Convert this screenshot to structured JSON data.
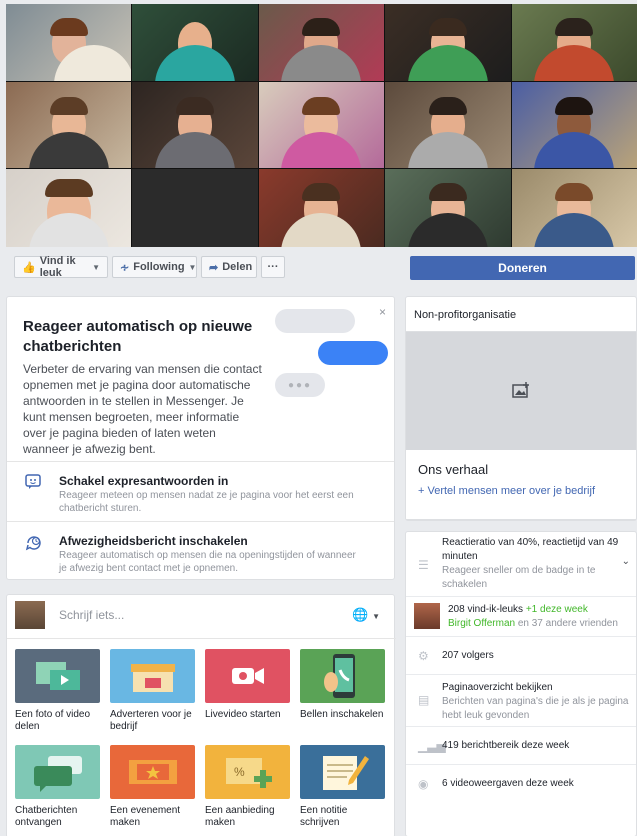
{
  "colors": {
    "accent": "#4267b2",
    "green": "#42b72a",
    "muted": "#90949c"
  },
  "actions": {
    "like": "Vind ik leuk",
    "following": "Following",
    "share": "Delen",
    "more": "···",
    "donate": "Doneren"
  },
  "promo": {
    "title": "Reageer automatisch op nieuwe chatberichten",
    "text": "Verbeter de ervaring van mensen die contact opnemen met je pagina door automatische antwoorden in te stellen in Messenger. Je kunt mensen begroeten, meer informatie over je pagina bieden of laten weten wanneer je afwezig bent.",
    "close": "×",
    "options": [
      {
        "icon": "chat-smile-icon",
        "title": "Schakel expresantwoorden in",
        "desc": "Reageer meteen op mensen nadat ze je pagina voor het eerst een chatbericht sturen."
      },
      {
        "icon": "chat-clock-icon",
        "title": "Afwezigheidsbericht inschakelen",
        "desc": "Reageer automatisch op mensen die na openingstijden of wanneer je afwezig bent contact met je opnemen."
      }
    ]
  },
  "composer": {
    "placeholder": "Schrijf iets...",
    "tiles": [
      {
        "label": "Een foto of video delen",
        "icon": "photo-video-icon",
        "color": "#5a6b7d"
      },
      {
        "label": "Adverteren voor je bedrijf",
        "icon": "storefront-icon",
        "color": "#69b7e3"
      },
      {
        "label": "Livevideo starten",
        "icon": "live-camera-icon",
        "color": "#e05262"
      },
      {
        "label": "Bellen inschakelen",
        "icon": "phone-call-icon",
        "color": "#5aa356"
      },
      {
        "label": "Chatberichten ontvangen",
        "icon": "chat-bubbles-icon",
        "color": "#7fc8b5"
      },
      {
        "label": "Een evenement maken",
        "icon": "ticket-icon",
        "color": "#e8683a"
      },
      {
        "label": "Een aanbieding maken",
        "icon": "coupon-icon",
        "color": "#f2b33d"
      },
      {
        "label": "Een notitie schrijven",
        "icon": "note-pencil-icon",
        "color": "#3a6f9a"
      }
    ]
  },
  "sidebar": {
    "category": "Non-profitorganisatie",
    "story_title": "Ons verhaal",
    "story_link": "+ Vertel mensen meer over je bedrijf",
    "response": "Reactieratio van 40%, reactietijd van 49 minuten",
    "response_sub": "Reageer sneller om de badge in te schakelen",
    "likes": "208 vind-ik-leuks",
    "likes_week": "+1 deze week",
    "likes_friend": "Birgit Offerman",
    "likes_others": "en 37 andere vrienden",
    "followers": "207 volgers",
    "overview": "Paginaoverzicht bekijken",
    "overview_sub": "Berichten van pagina's die je als je pagina hebt leuk gevonden",
    "reach": "419 berichtbereik deze week",
    "views": "6 videoweergaven deze week"
  }
}
